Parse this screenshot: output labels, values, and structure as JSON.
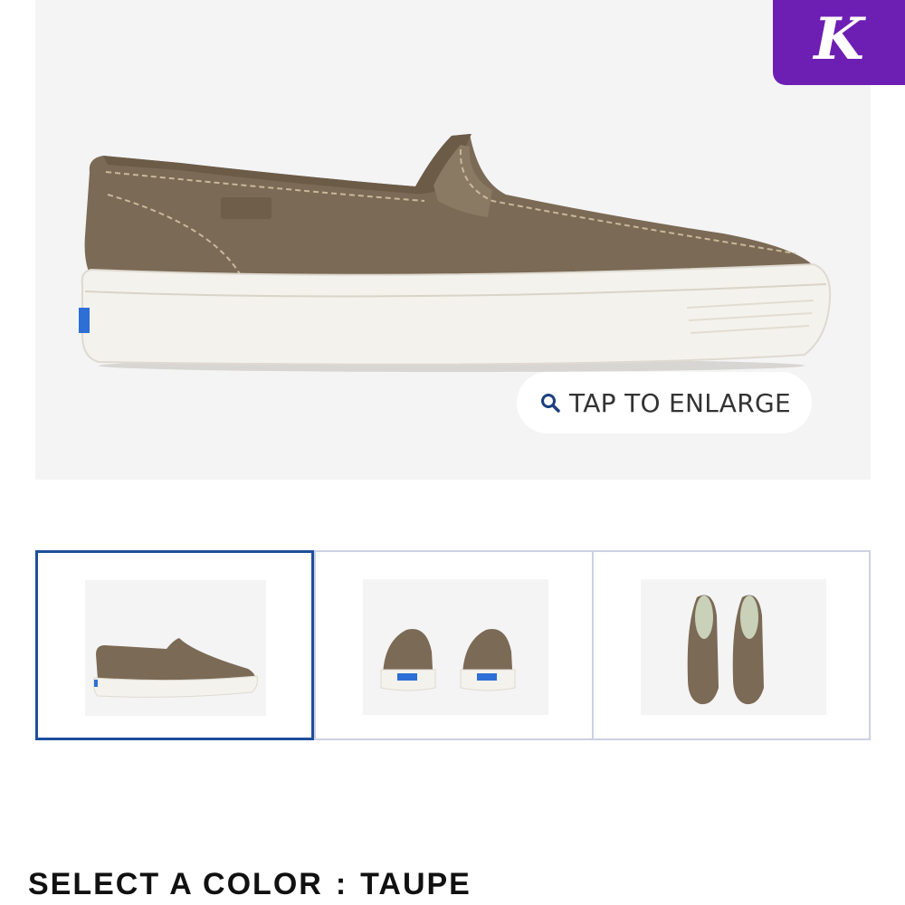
{
  "hero": {
    "image_alt": "Taupe suede slip-on sneaker, side view",
    "enlarge_label": "TAP TO ENLARGE",
    "enlarge_icon": "search-icon"
  },
  "brand_badge": {
    "letter": "K",
    "color": "#6e1fb3"
  },
  "thumbnails": [
    {
      "view": "side",
      "selected": true
    },
    {
      "view": "back",
      "selected": false
    },
    {
      "view": "top",
      "selected": false
    }
  ],
  "color_selector": {
    "label": "SELECT A COLOR",
    "separator": ":",
    "value": "TAUPE"
  },
  "colors": {
    "shoe_upper": "#7b6a55",
    "sole": "#f4f2ec",
    "selected_border": "#1d4f9c",
    "thumb_border": "#ccd2e3",
    "background": "#f4f4f5"
  }
}
